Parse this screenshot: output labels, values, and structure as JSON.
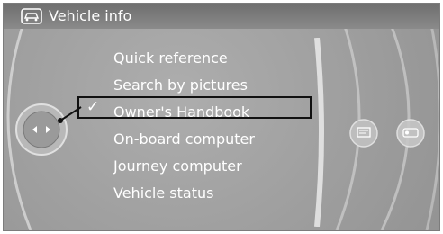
{
  "header": {
    "title": "Vehicle info",
    "icon": "car-info-icon"
  },
  "menu": {
    "items": [
      {
        "label": "Quick reference"
      },
      {
        "label": "Search by pictures"
      },
      {
        "label": "Owner's Handbook",
        "selected": true
      },
      {
        "label": "On-board computer"
      },
      {
        "label": "Journey computer"
      },
      {
        "label": "Vehicle status"
      }
    ],
    "check_mark": "✓"
  },
  "right_panel": {
    "buttons": [
      {
        "icon": "on-board-computer-icon"
      },
      {
        "icon": "journey-computer-icon"
      }
    ]
  },
  "colors": {
    "background": "#a4a4a4",
    "header": "#7c7c7c",
    "text": "#ffffff",
    "selection_frame": "#111111"
  }
}
